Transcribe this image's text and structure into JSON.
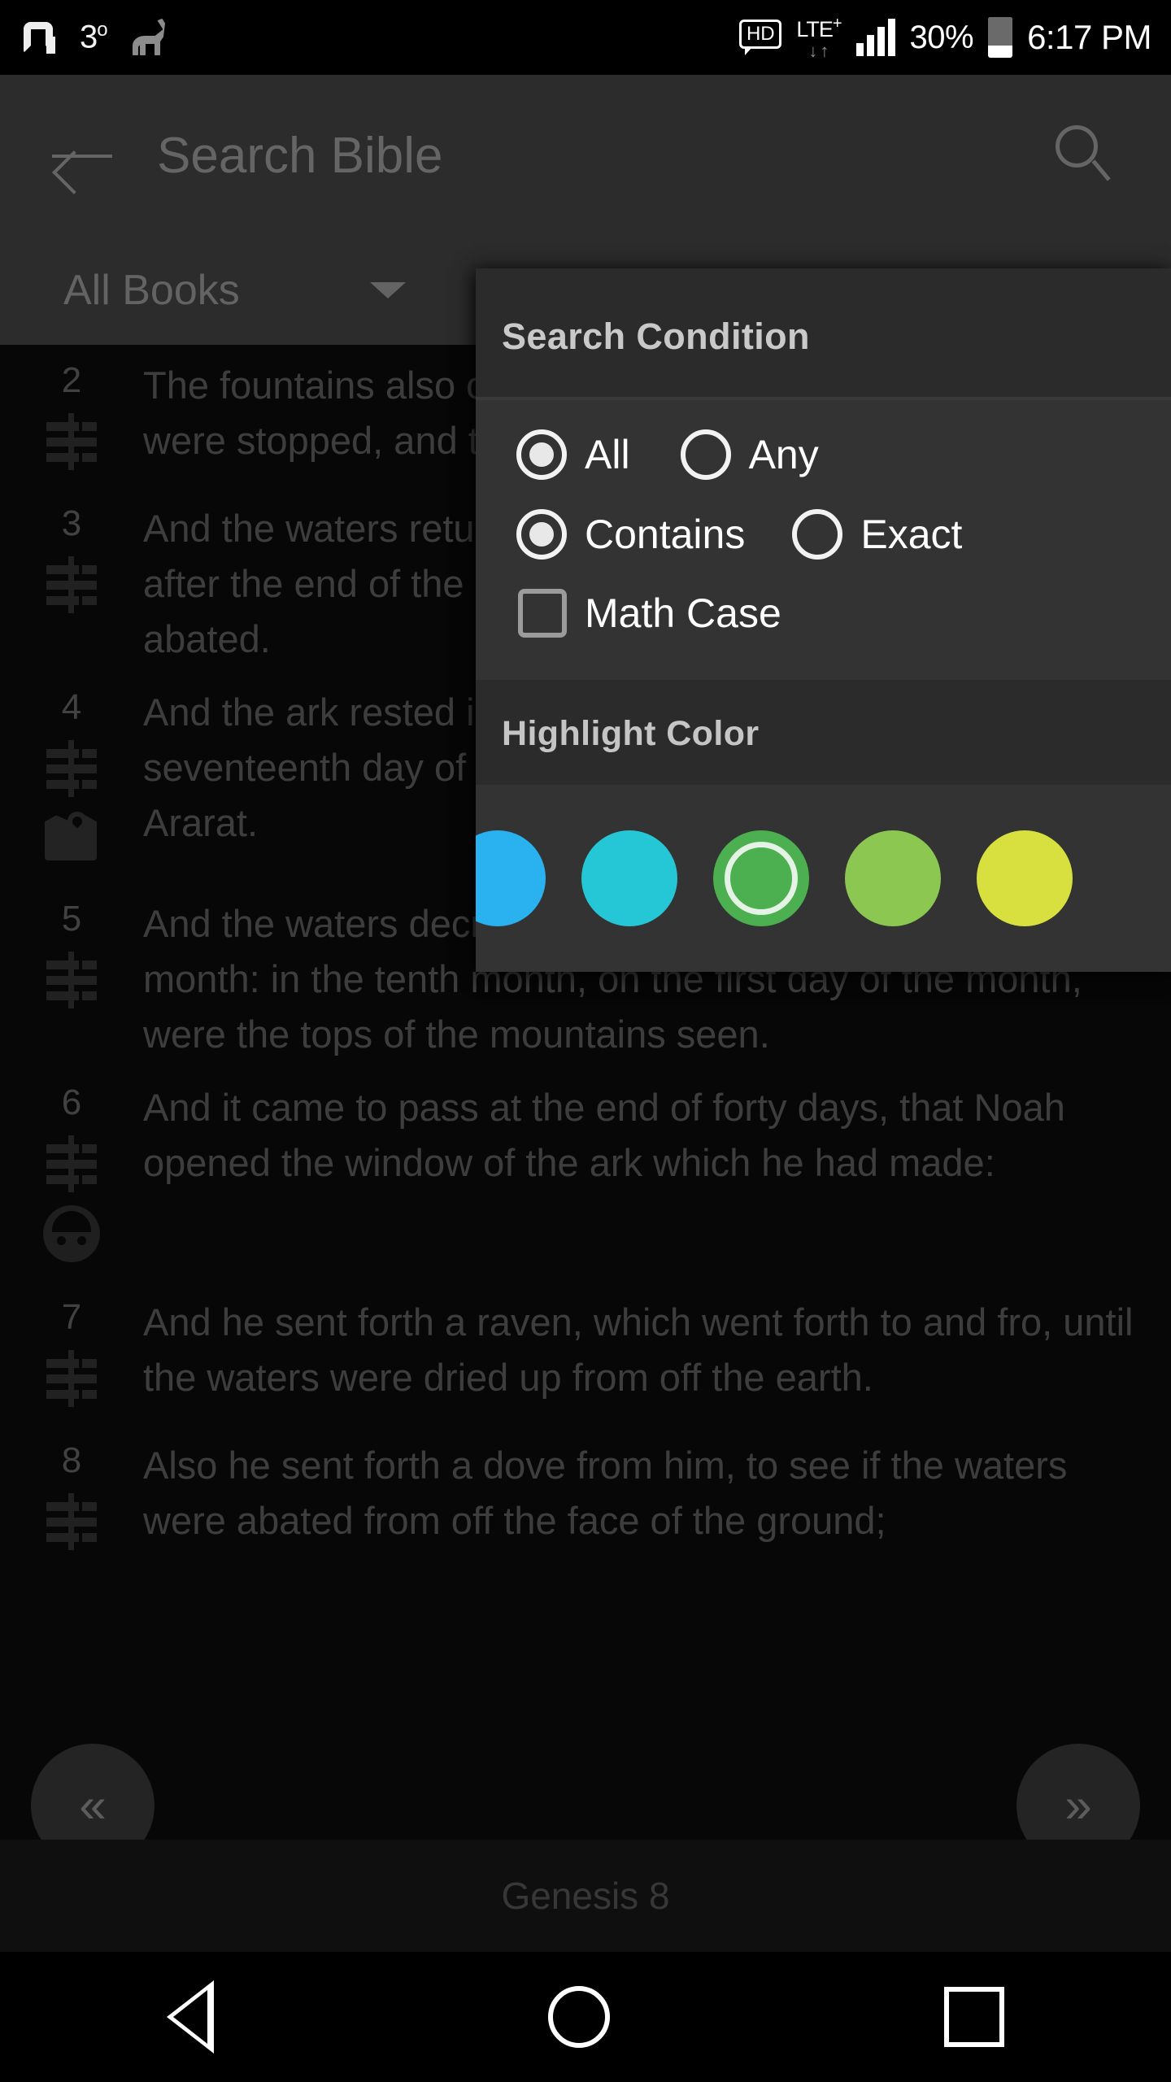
{
  "status_bar": {
    "logo_icon": "app-logo-icon",
    "temperature": "3",
    "temperature_unit": "o",
    "pet_icon": "llama-icon",
    "hd_label": "HD",
    "network_label": "LTE",
    "network_plus": "+",
    "data_arrows_icon": "data-transfer-arrows-icon",
    "signal_icon": "signal-bars-icon",
    "battery_percent": "30%",
    "battery_icon": "battery-icon",
    "clock": "6:17 PM"
  },
  "toolbar": {
    "back_icon": "back-arrow-icon",
    "title": "Search Bible",
    "search_icon": "search-icon"
  },
  "filter_bar": {
    "selected_scope": "All Books",
    "caret_icon": "chevron-down-icon"
  },
  "condition_panel": {
    "title": "Search Condition",
    "match_mode": [
      {
        "label": "All",
        "selected": true
      },
      {
        "label": "Any",
        "selected": false
      }
    ],
    "compare_mode": [
      {
        "label": "Contains",
        "selected": true
      },
      {
        "label": "Exact",
        "selected": false
      }
    ],
    "case_option": {
      "label": "Math Case",
      "checked": false
    },
    "highlight_section_title": "Highlight Color",
    "highlight_colors": [
      {
        "name": "blue",
        "hex": "#29B1F0",
        "selected": false
      },
      {
        "name": "cyan",
        "hex": "#25C6D6",
        "selected": false
      },
      {
        "name": "green",
        "hex": "#4CAF50",
        "selected": true
      },
      {
        "name": "light-green",
        "hex": "#8CC751",
        "selected": false
      },
      {
        "name": "yellow",
        "hex": "#D8E03F",
        "selected": false
      }
    ]
  },
  "reader": {
    "verses": [
      {
        "number": "2",
        "text": "The fountains also of the deep and the windows of heaven were stopped, and the rain from heaven was restrained;",
        "icons": [
          "note-icon"
        ]
      },
      {
        "number": "3",
        "text": "And the waters returned from off the earth continually: and after the end of the hundred and fifty days the waters were abated.",
        "icons": [
          "note-icon"
        ]
      },
      {
        "number": "4",
        "text": "And the ark rested in the seventh month, on the seventeenth day of the month, upon the mountains of Ararat.",
        "icons": [
          "note-icon",
          "map-icon"
        ]
      },
      {
        "number": "5",
        "text": "And the waters decreased continually until the tenth month: in the tenth month, on the first day of the month, were the tops of the mountains seen.",
        "icons": [
          "note-icon"
        ]
      },
      {
        "number": "6",
        "text": "And it came to pass at the end of forty days, that Noah opened the window of the ark which he had made:",
        "icons": [
          "note-icon",
          "person-icon"
        ]
      },
      {
        "number": "7",
        "text": "And he sent forth a raven, which went forth to and fro, until the waters were dried up from off the earth.",
        "icons": [
          "note-icon"
        ]
      },
      {
        "number": "8",
        "text": "Also he sent forth a dove from him, to see if the waters were abated from off the face of the ground;",
        "icons": [
          "note-icon"
        ]
      }
    ],
    "footer_reference": "Genesis 8",
    "prev_label": "«",
    "next_label": "»"
  },
  "android_nav": {
    "back_icon": "android-back-icon",
    "home_icon": "android-home-icon",
    "recents_icon": "android-recents-icon"
  }
}
